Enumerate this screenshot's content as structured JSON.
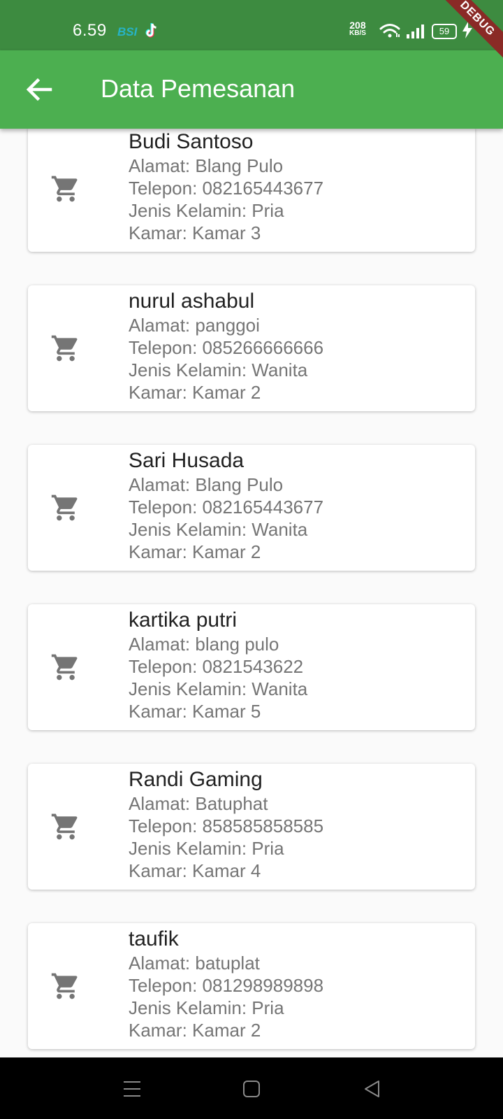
{
  "status_bar": {
    "time": "6.59",
    "bsi_label": "BSI",
    "net_speed_value": "208",
    "net_speed_unit": "KB/S",
    "battery": "59",
    "background_color": "#3d8b40"
  },
  "debug_banner": "DEBUG",
  "app_bar": {
    "title": "Data Pemesanan",
    "back_icon": "arrow-back-icon",
    "background_color": "#4caf50"
  },
  "bookings": [
    {
      "name": "Budi Santoso",
      "address": "Alamat: Blang Pulo",
      "phone": "Telepon: 082165443677",
      "gender": "Jenis Kelamin: Pria",
      "room": "Kamar: Kamar 3"
    },
    {
      "name": "nurul ashabul",
      "address": "Alamat: panggoi",
      "phone": "Telepon: 085266666666",
      "gender": "Jenis Kelamin: Wanita",
      "room": "Kamar: Kamar 2"
    },
    {
      "name": "Sari Husada",
      "address": "Alamat: Blang Pulo",
      "phone": "Telepon: 082165443677",
      "gender": "Jenis Kelamin: Wanita",
      "room": "Kamar: Kamar 2"
    },
    {
      "name": "kartika putri",
      "address": "Alamat: blang pulo",
      "phone": "Telepon: 0821543622",
      "gender": "Jenis Kelamin: Wanita",
      "room": "Kamar: Kamar 5"
    },
    {
      "name": "Randi Gaming",
      "address": "Alamat: Batuphat",
      "phone": "Telepon: 858585858585",
      "gender": "Jenis Kelamin: Pria",
      "room": "Kamar: Kamar 4"
    },
    {
      "name": "taufik",
      "address": "Alamat: batuplat",
      "phone": "Telepon: 081298989898",
      "gender": "Jenis Kelamin: Pria",
      "room": "Kamar: Kamar 2"
    }
  ],
  "list_icon": "shopping-cart-icon",
  "nav_bar": {
    "recents_icon": "menu-icon",
    "home_icon": "home-square-icon",
    "back_icon": "back-triangle-icon"
  }
}
